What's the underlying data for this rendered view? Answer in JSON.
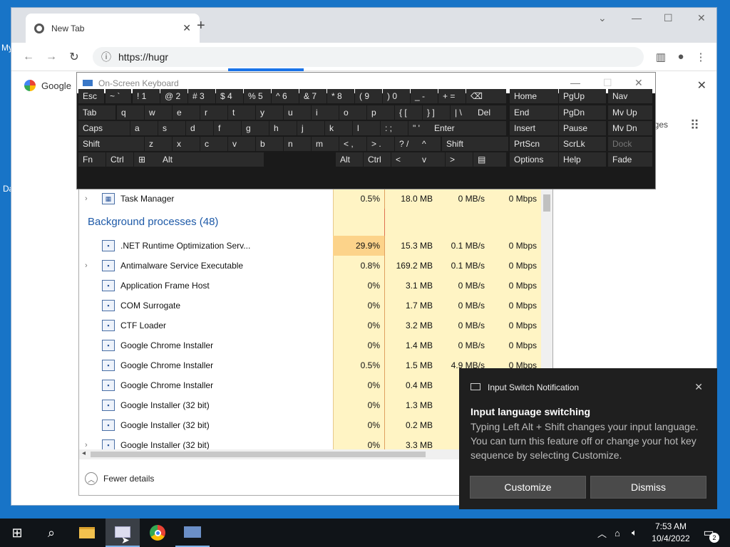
{
  "desktop": {
    "label_my": "My",
    "label_da": "Da"
  },
  "chrome": {
    "tab_title": "New Tab",
    "url": "https://hugr",
    "bookmark_google": "Google",
    "partial_text": "ges",
    "close_x": "✕"
  },
  "osk": {
    "title": "On-Screen Keyboard",
    "rows": [
      [
        "Esc",
        "~ `",
        "! 1",
        "@ 2",
        "# 3",
        "$ 4",
        "% 5",
        "^ 6",
        "& 7",
        "* 8",
        "( 9",
        ") 0",
        "_ -",
        "+ =",
        "⌫",
        "Home",
        "PgUp",
        "Nav"
      ],
      [
        "Tab",
        "q",
        "w",
        "e",
        "r",
        "t",
        "y",
        "u",
        "i",
        "o",
        "p",
        "{ [",
        "} ]",
        "| \\",
        "Del",
        "End",
        "PgDn",
        "Mv Up"
      ],
      [
        "Caps",
        "a",
        "s",
        "d",
        "f",
        "g",
        "h",
        "j",
        "k",
        "l",
        ": ;",
        "\" '",
        "Enter",
        "Insert",
        "Pause",
        "Mv Dn"
      ],
      [
        "Shift",
        "z",
        "x",
        "c",
        "v",
        "b",
        "n",
        "m",
        "< ,",
        "> .",
        "? /",
        "^",
        "Shift",
        "PrtScn",
        "ScrLk",
        "Dock"
      ],
      [
        "Fn",
        "Ctrl",
        "⊞",
        "Alt",
        "Alt",
        "Ctrl",
        "<",
        "v",
        ">",
        "▤",
        "Options",
        "Help",
        "Fade"
      ]
    ]
  },
  "taskman": {
    "top_row": {
      "name": "Task Manager",
      "cpu": "0.5%",
      "mem": "18.0 MB",
      "disk": "0 MB/s",
      "net": "0 Mbps"
    },
    "bg_header": "Background processes (48)",
    "processes": [
      {
        "name": ".NET Runtime Optimization Serv...",
        "cpu": "29.9%",
        "mem": "15.3 MB",
        "disk": "0.1 MB/s",
        "net": "0 Mbps",
        "expand": false
      },
      {
        "name": "Antimalware Service Executable",
        "cpu": "0.8%",
        "mem": "169.2 MB",
        "disk": "0.1 MB/s",
        "net": "0 Mbps",
        "expand": true
      },
      {
        "name": "Application Frame Host",
        "cpu": "0%",
        "mem": "3.1 MB",
        "disk": "0 MB/s",
        "net": "0 Mbps",
        "expand": false
      },
      {
        "name": "COM Surrogate",
        "cpu": "0%",
        "mem": "1.7 MB",
        "disk": "0 MB/s",
        "net": "0 Mbps",
        "expand": false
      },
      {
        "name": "CTF Loader",
        "cpu": "0%",
        "mem": "3.2 MB",
        "disk": "0 MB/s",
        "net": "0 Mbps",
        "expand": false
      },
      {
        "name": "Google Chrome Installer",
        "cpu": "0%",
        "mem": "1.4 MB",
        "disk": "0 MB/s",
        "net": "0 Mbps",
        "expand": false
      },
      {
        "name": "Google Chrome Installer",
        "cpu": "0.5%",
        "mem": "1.5 MB",
        "disk": "4.9 MB/s",
        "net": "0 Mbps",
        "expand": false
      },
      {
        "name": "Google Chrome Installer",
        "cpu": "0%",
        "mem": "0.4 MB",
        "disk": "",
        "net": "",
        "expand": false
      },
      {
        "name": "Google Installer (32 bit)",
        "cpu": "0%",
        "mem": "1.3 MB",
        "disk": "",
        "net": "",
        "expand": false
      },
      {
        "name": "Google Installer (32 bit)",
        "cpu": "0%",
        "mem": "0.2 MB",
        "disk": "",
        "net": "",
        "expand": false
      },
      {
        "name": "Google Installer (32 bit)",
        "cpu": "0%",
        "mem": "3.3 MB",
        "disk": "",
        "net": "",
        "expand": true
      }
    ],
    "fewer_details": "Fewer details"
  },
  "notification": {
    "app": "Input Switch Notification",
    "heading": "Input language switching",
    "body": "Typing Left Alt + Shift changes your input language. You can turn this feature off or change your hot key sequence by selecting Customize.",
    "customize": "Customize",
    "dismiss": "Dismiss"
  },
  "taskbar": {
    "time": "7:53 AM",
    "date": "10/4/2022",
    "notif_count": "2"
  }
}
